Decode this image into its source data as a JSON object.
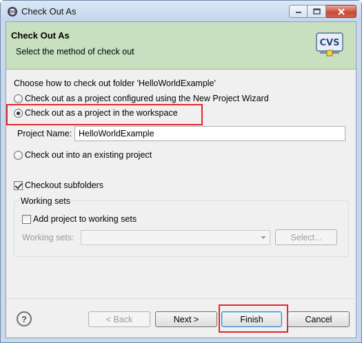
{
  "window": {
    "title": "Check Out As"
  },
  "banner": {
    "title": "Check Out As",
    "description": "Select the method of check out",
    "icon_text": "CVS"
  },
  "options": {
    "heading": "Choose how to check out folder 'HelloWorldExample'",
    "radio_wizard": "Check out as a project configured using the New Project Wizard",
    "radio_workspace": "Check out as a project in the workspace",
    "selected": "radio_workspace",
    "project_name_label": "Project Name:",
    "project_name_value": "HelloWorldExample",
    "radio_existing": "Check out into an existing project",
    "checkout_subfolders_label": "Checkout subfolders",
    "checkout_subfolders_checked": true
  },
  "working_sets": {
    "group_title": "Working sets",
    "add_label": "Add project to working sets",
    "add_checked": false,
    "sets_label": "Working sets:",
    "sets_value": "",
    "select_button": "Select..."
  },
  "footer": {
    "help_icon": "question-icon",
    "back": "< Back",
    "next": "Next >",
    "finish": "Finish",
    "cancel": "Cancel"
  },
  "colors": {
    "highlight": "#e0262b",
    "banner_bg": "#c8e0c0"
  }
}
